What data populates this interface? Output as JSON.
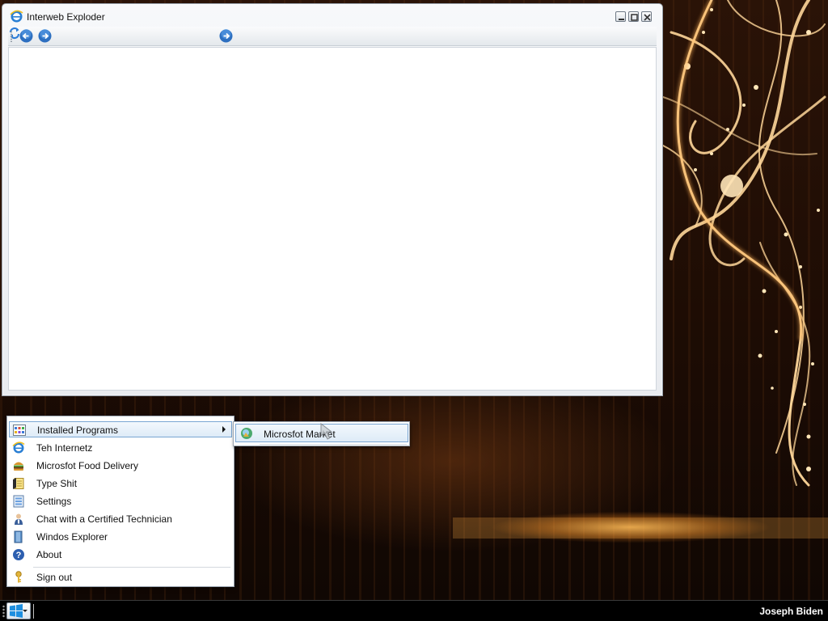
{
  "browser": {
    "title": "Interweb Exploder",
    "icon": "ie-icon",
    "buttons": {
      "minimize": "minimize-icon",
      "maximize": "maximize-icon",
      "close": "close-icon"
    },
    "nav": {
      "back": "back-arrow-icon",
      "forward": "forward-arrow-icon",
      "go": "go-arrow-icon",
      "refresh": "refresh-icon"
    }
  },
  "start_menu": {
    "items": [
      {
        "label": "Installed Programs",
        "icon": "programs-grid-icon",
        "has_submenu": true,
        "active": true
      },
      {
        "label": "Teh Internetz",
        "icon": "ie-icon"
      },
      {
        "label": "Microsfot Food Delivery",
        "icon": "burger-icon"
      },
      {
        "label": "Type Shit",
        "icon": "notepad-icon"
      },
      {
        "label": "Settings",
        "icon": "settings-icon"
      },
      {
        "label": "Chat with a Certified Technician",
        "icon": "technician-icon"
      },
      {
        "label": "Windos Explorer",
        "icon": "folder-icon"
      },
      {
        "label": "About",
        "icon": "help-icon"
      },
      {
        "label": "Sign out",
        "icon": "key-icon"
      }
    ]
  },
  "submenu": {
    "items": [
      {
        "label": "Microsfot Market",
        "icon": "market-icon"
      }
    ]
  },
  "taskbar": {
    "user_name": "Joseph Biden",
    "start_icon": "windows-logo-icon"
  },
  "colors": {
    "accent": "#7aa6d3",
    "taskbar": "#000000",
    "window_chrome": "#e9ecf0"
  }
}
